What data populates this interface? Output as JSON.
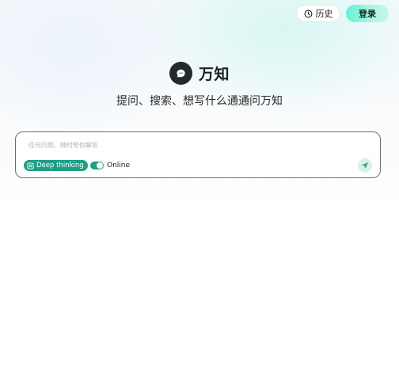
{
  "header": {
    "history_label": "历史",
    "login_label": "登录"
  },
  "brand": {
    "name": "万知",
    "tagline": "提问、搜索、想写什么通通问万知"
  },
  "composer": {
    "placeholder": "任何问题，随时帮你解答",
    "value": "",
    "deep_thinking_label": "Deep thinking",
    "online_label": "Online",
    "online_enabled": true
  },
  "icons": {
    "history": "clock-icon",
    "logo": "chat-bubble-logo-icon",
    "deep_thinking": "atom-icon",
    "send": "send-icon"
  },
  "colors": {
    "accent": "#1f9e84",
    "login_gradient_start": "#66f1d8",
    "login_gradient_end": "#c8f7e5",
    "logo_bg": "#222a2c",
    "send_bg": "#d9f1ec"
  }
}
